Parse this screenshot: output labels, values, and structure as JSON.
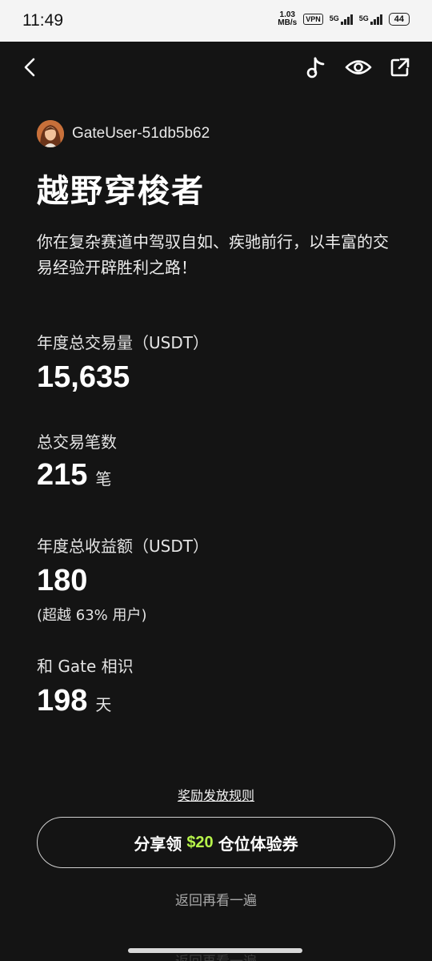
{
  "status_bar": {
    "time": "11:49",
    "net_speed_value": "1.03",
    "net_speed_unit": "MB/s",
    "vpn": "VPN",
    "signal_1": "5G",
    "signal_2": "5G",
    "battery": "44"
  },
  "toolbar": {
    "back_icon": "chevron-left-icon",
    "music_icon": "music-note-icon",
    "eye_icon": "eye-icon",
    "share_icon": "external-share-icon"
  },
  "profile": {
    "username": "GateUser-51db5b62"
  },
  "report": {
    "title": "越野穿梭者",
    "description": "你在复杂赛道中驾驭自如、疾驰前行，以丰富的交易经验开辟胜利之路！"
  },
  "stats": {
    "volume_label": "年度总交易量（USDT）",
    "volume_value": "15,635",
    "trades_label": "总交易笔数",
    "trades_value": "215",
    "trades_unit": "笔",
    "profit_label": "年度总收益额（USDT）",
    "profit_value": "180",
    "profit_note": "(超越 63% 用户)",
    "days_label": "和 Gate 相识",
    "days_value": "198",
    "days_unit": "天"
  },
  "actions": {
    "rules_link": "奖励发放规则",
    "share_prefix": "分享领",
    "share_amount": "$20",
    "share_suffix": "仓位体验券",
    "replay": "返回再看一遍",
    "replay_ghost": "返回再看一遍"
  },
  "colors": {
    "background": "#141414",
    "accent_green": "#b6f34a",
    "text_primary": "#ffffff"
  }
}
